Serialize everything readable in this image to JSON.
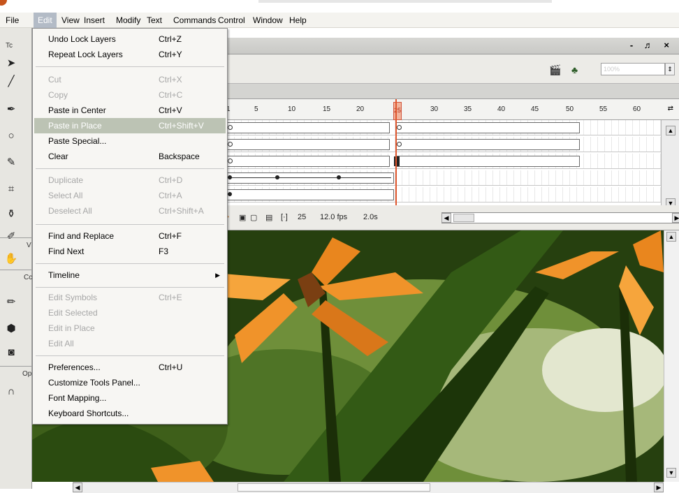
{
  "menubar": {
    "items": [
      "File",
      "Edit",
      "View",
      "Insert",
      "Modify",
      "Text",
      "Commands",
      "Control",
      "Window",
      "Help"
    ],
    "active": "Edit"
  },
  "tools_panel": {
    "labels": [
      "Tc",
      "V",
      "Cc",
      "Op"
    ]
  },
  "edit_menu": {
    "undo": {
      "label": "Undo Lock Layers",
      "shortcut": "Ctrl+Z"
    },
    "repeat": {
      "label": "Repeat Lock Layers",
      "shortcut": "Ctrl+Y"
    },
    "cut": {
      "label": "Cut",
      "shortcut": "Ctrl+X"
    },
    "copy": {
      "label": "Copy",
      "shortcut": "Ctrl+C"
    },
    "paste_center": {
      "label": "Paste in Center",
      "shortcut": "Ctrl+V"
    },
    "paste_place": {
      "label": "Paste in Place",
      "shortcut": "Ctrl+Shift+V"
    },
    "paste_special": {
      "label": "Paste Special..."
    },
    "clear": {
      "label": "Clear",
      "shortcut": "Backspace"
    },
    "duplicate": {
      "label": "Duplicate",
      "shortcut": "Ctrl+D"
    },
    "select_all": {
      "label": "Select All",
      "shortcut": "Ctrl+A"
    },
    "deselect_all": {
      "label": "Deselect All",
      "shortcut": "Ctrl+Shift+A"
    },
    "find_replace": {
      "label": "Find and Replace",
      "shortcut": "Ctrl+F"
    },
    "find_next": {
      "label": "Find Next",
      "shortcut": "F3"
    },
    "timeline": {
      "label": "Timeline"
    },
    "edit_symbols": {
      "label": "Edit Symbols",
      "shortcut": "Ctrl+E"
    },
    "edit_selected": {
      "label": "Edit Selected"
    },
    "edit_in_place": {
      "label": "Edit in Place"
    },
    "edit_all": {
      "label": "Edit All"
    },
    "preferences": {
      "label": "Preferences...",
      "shortcut": "Ctrl+U"
    },
    "customize_tools": {
      "label": "Customize Tools Panel..."
    },
    "font_mapping": {
      "label": "Font Mapping..."
    },
    "keyboard_shortcuts": {
      "label": "Keyboard Shortcuts..."
    }
  },
  "document_window": {
    "controls": "- ♬ ×",
    "zoom_value": "100%"
  },
  "timeline": {
    "ruler_ticks": [
      "1",
      "5",
      "10",
      "15",
      "20",
      "25",
      "30",
      "35",
      "40",
      "45",
      "50",
      "55",
      "60"
    ],
    "current_frame_label": "25",
    "current_frame": "25",
    "frame_rate": "12.0 fps",
    "elapsed_time": "2.0s"
  },
  "colors": {
    "menu_highlight": "#bcc3b4",
    "playhead": "#e0572e",
    "petal_orange": "#f0932a",
    "leaf_green": "#3f6a1c"
  }
}
